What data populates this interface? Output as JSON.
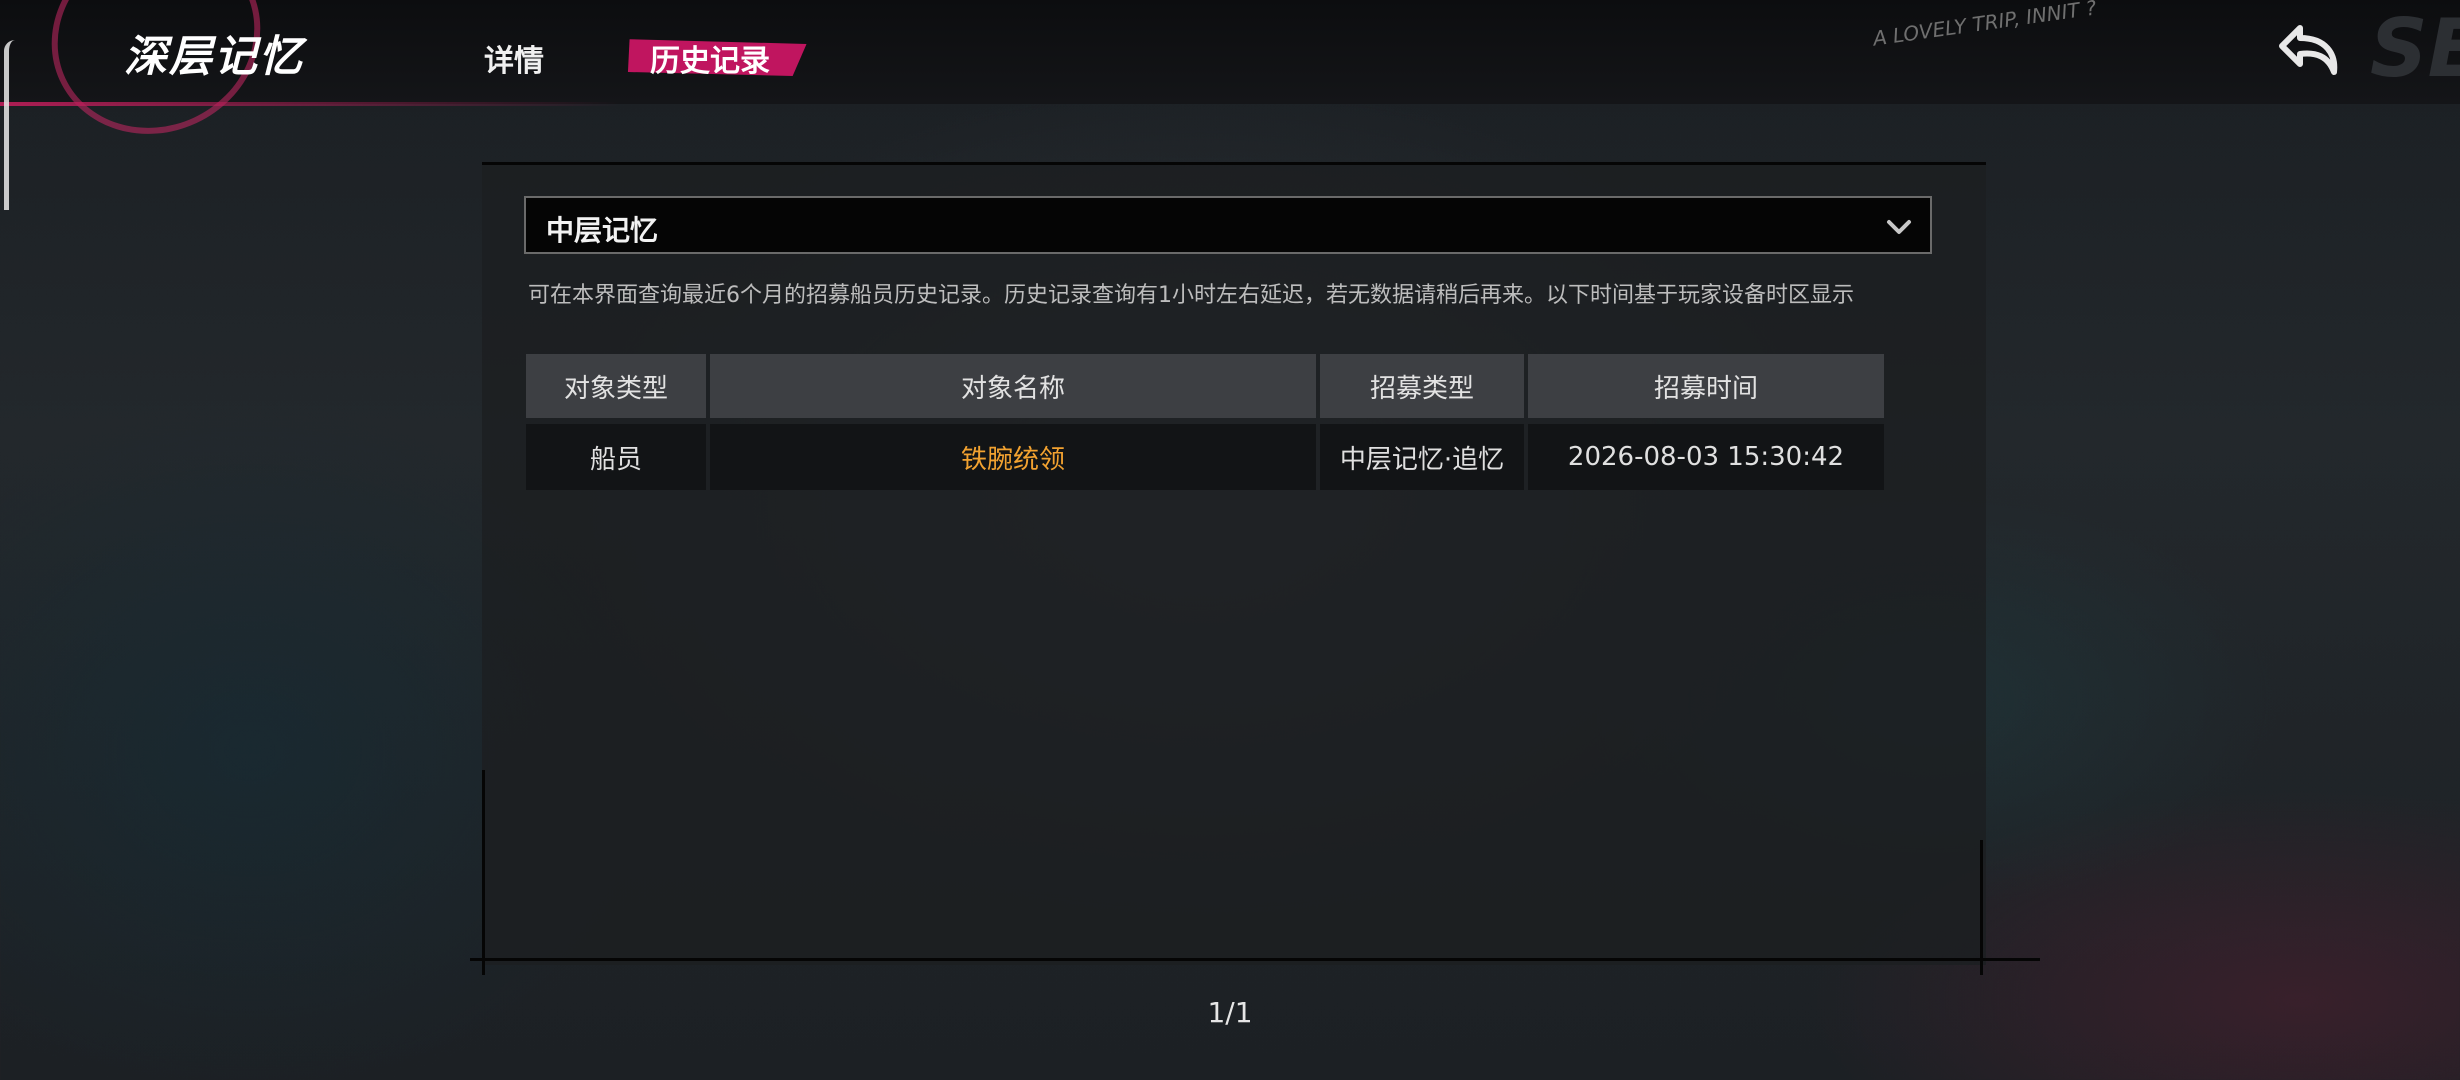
{
  "header": {
    "title": "深层记忆",
    "tabs": [
      {
        "label": "详情",
        "active": false
      },
      {
        "label": "历史记录",
        "active": true
      }
    ],
    "decor_text": "A LOVELY TRIP, INNIT ?",
    "decor_big": "SE",
    "back_icon": "back-arrow-icon"
  },
  "filter": {
    "selected": "中层记忆",
    "chevron_icon": "chevron-down-icon"
  },
  "notice": "可在本界面查询最近6个月的招募船员历史记录。历史记录查询有1小时左右延迟，若无数据请稍后再来。以下时间基于玩家设备时区显示",
  "table": {
    "headers": [
      "对象类型",
      "对象名称",
      "招募类型",
      "招募时间"
    ],
    "rows": [
      {
        "type": "船员",
        "name": "铁腕统领",
        "recruit_type": "中层记忆·追忆",
        "time": "2026-08-03 15:30:42"
      }
    ]
  },
  "pagination": "1/1",
  "colors": {
    "accent": "#c0155f",
    "highlight_name": "#f2a230"
  }
}
